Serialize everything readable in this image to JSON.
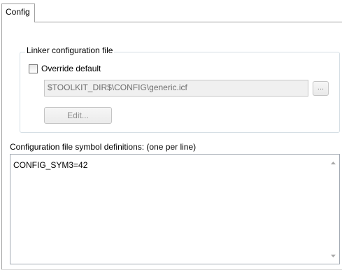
{
  "tab": {
    "label": "Config"
  },
  "linker_group": {
    "legend": "Linker configuration file",
    "override_checkbox": {
      "label": "Override default",
      "checked": false
    },
    "config_file_path": "$TOOLKIT_DIR$\\CONFIG\\generic.icf",
    "browse_label": "...",
    "edit_label": "Edit..."
  },
  "symbols": {
    "label": "Configuration file symbol definitions: (one per line)",
    "text": "CONFIG_SYM3=42"
  },
  "icons": {
    "scroll_up": "scroll-up-arrow-icon",
    "scroll_down": "scroll-down-arrow-icon"
  }
}
